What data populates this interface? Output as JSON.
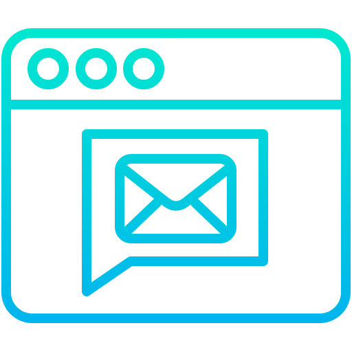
{
  "icon": {
    "name": "browser-window-email-message-icon",
    "style": "outline",
    "gradient": {
      "top_color": "#00E8D0",
      "bottom_color": "#00B4EE",
      "direction": "vertical"
    },
    "background": "#FFFFFF",
    "parts": {
      "window": "browser-window-icon",
      "dots": [
        "window-dot-icon",
        "window-dot-icon",
        "window-dot-icon"
      ],
      "speech_bubble": "speech-bubble-icon",
      "envelope": "envelope-icon"
    }
  }
}
